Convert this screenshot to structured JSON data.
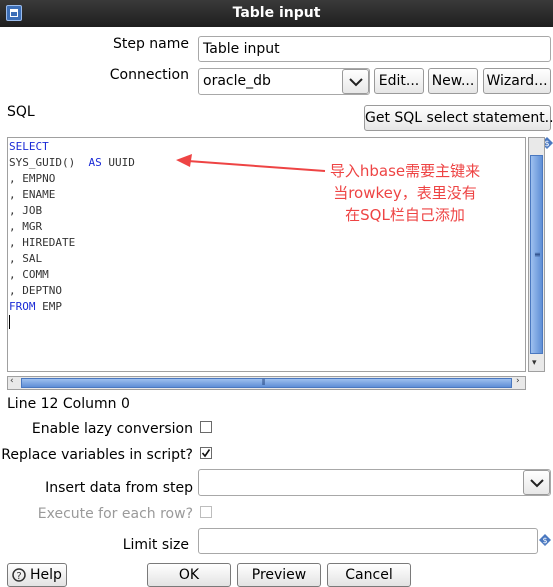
{
  "window": {
    "title": "Table input"
  },
  "step_name": {
    "label": "Step name",
    "value": "Table input"
  },
  "connection": {
    "label": "Connection",
    "value": "oracle_db",
    "edit_label": "Edit...",
    "new_label": "New...",
    "wizard_label": "Wizard..."
  },
  "sql": {
    "label": "SQL",
    "get_sql_label": "Get SQL select statement...",
    "lines": [
      {
        "kw": "SELECT",
        "text": ""
      },
      {
        "kw": "",
        "text": "SYS_GUID()  ",
        "kw2": "AS",
        "text2": " UUID"
      },
      {
        "kw": "",
        "text": ", EMPNO"
      },
      {
        "kw": "",
        "text": ", ENAME"
      },
      {
        "kw": "",
        "text": ", JOB"
      },
      {
        "kw": "",
        "text": ", MGR"
      },
      {
        "kw": "",
        "text": ", HIREDATE"
      },
      {
        "kw": "",
        "text": ", SAL"
      },
      {
        "kw": "",
        "text": ", COMM"
      },
      {
        "kw": "",
        "text": ", DEPTNO"
      },
      {
        "kw": "FROM",
        "text": " EMP"
      }
    ],
    "annotation": [
      "导入hbase需要主键来",
      "当rowkey，表里没有",
      "在SQL栏自己添加"
    ],
    "position": "Line 12 Column 0",
    "annotation_color": "#ee4444"
  },
  "options": {
    "lazy_label": "Enable lazy conversion",
    "lazy_checked": false,
    "replace_label": "Replace variables in script?",
    "replace_checked": true,
    "insert_label": "Insert data from step",
    "insert_value": "",
    "execute_label": "Execute for each row?",
    "execute_checked": false,
    "limit_label": "Limit size",
    "limit_value": ""
  },
  "buttons": {
    "help": "Help",
    "ok": "OK",
    "preview": "Preview",
    "cancel": "Cancel"
  },
  "colors": {
    "keyword": "#1b2bd6",
    "scroll_thumb": "#5f8fd6"
  }
}
